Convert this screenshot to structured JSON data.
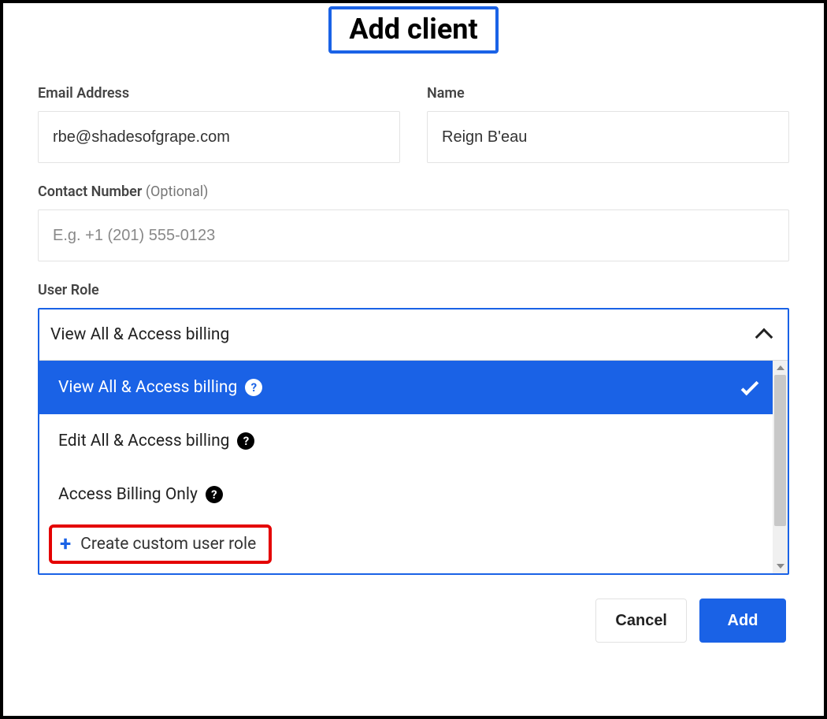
{
  "dialog": {
    "title": "Add client"
  },
  "form": {
    "email": {
      "label": "Email Address",
      "value": "rbe@shadesofgrape.com"
    },
    "name": {
      "label": "Name",
      "value": "Reign B'eau"
    },
    "contact": {
      "label": "Contact Number",
      "optional": "(Optional)",
      "placeholder": "E.g. +1 (201) 555-0123"
    }
  },
  "role": {
    "label": "User Role",
    "selected": "View All & Access billing",
    "options": {
      "o0": "View All & Access billing",
      "o1": "Edit All & Access billing",
      "o2": "Access Billing Only"
    },
    "create_custom": "Create custom user role"
  },
  "footer": {
    "cancel": "Cancel",
    "add": "Add"
  }
}
